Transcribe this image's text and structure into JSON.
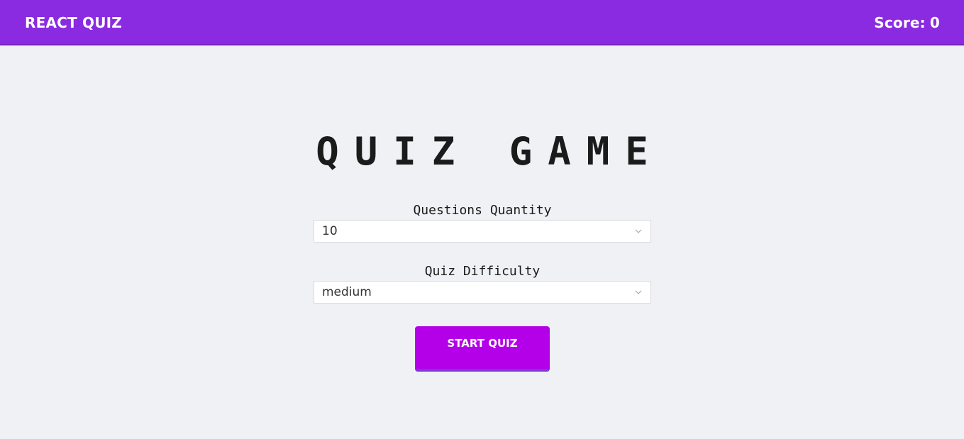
{
  "header": {
    "brand": "REACT QUIZ",
    "score_label": "Score:",
    "score_value": "0"
  },
  "main": {
    "title": "QUIZ GAME",
    "quantity": {
      "label": "Questions Quantity",
      "value": "10",
      "icon": "chevron-down-icon"
    },
    "difficulty": {
      "label": "Quiz Difficulty",
      "value": "medium",
      "icon": "chevron-down-icon"
    },
    "start_label": "START QUIZ"
  },
  "colors": {
    "header_bg": "#8a2be2",
    "page_bg": "#f0f1f5",
    "button_bg": "#b400e8",
    "button_border": "#7a3bd0"
  }
}
